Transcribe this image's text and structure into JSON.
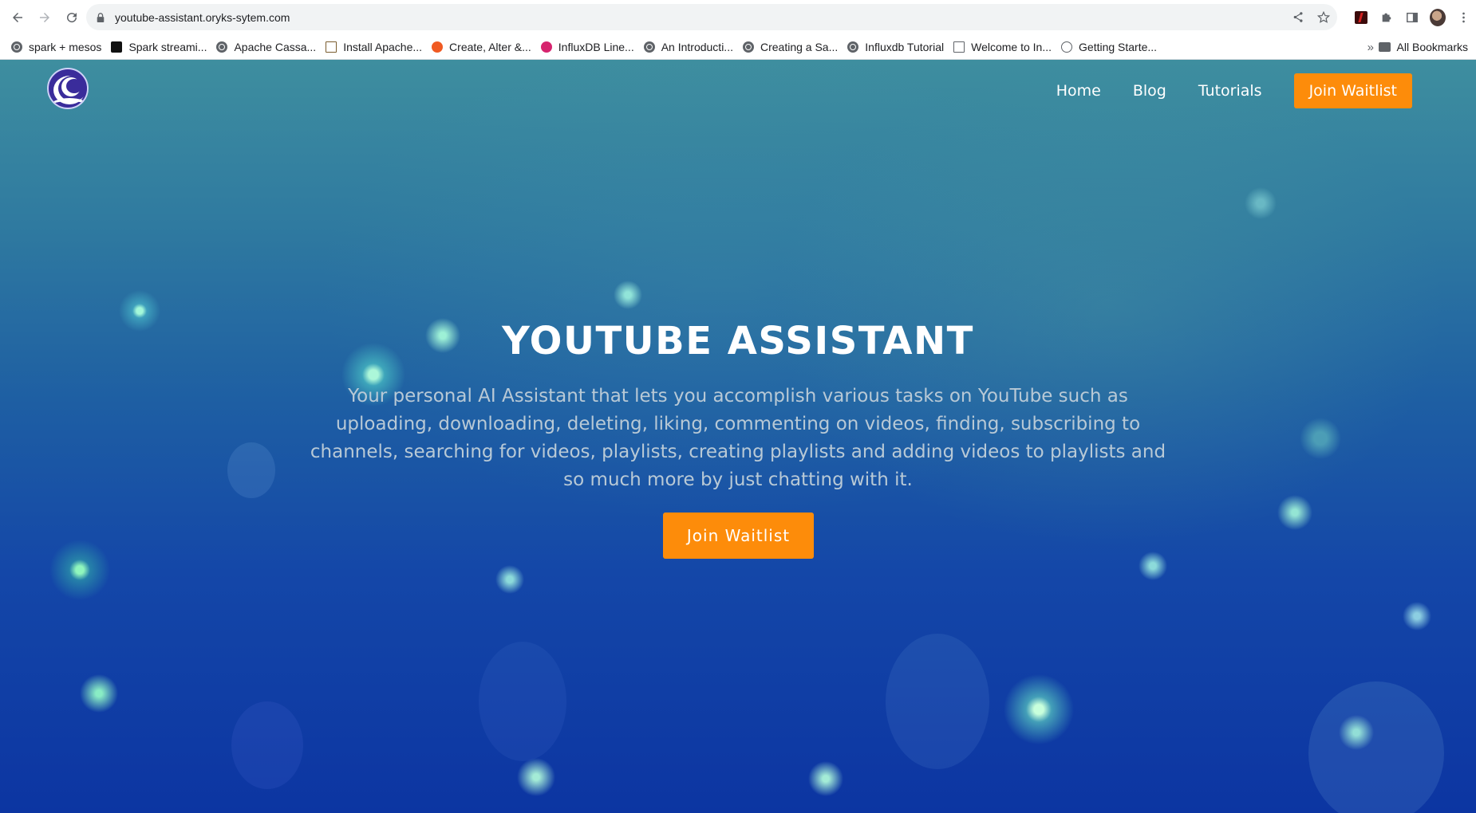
{
  "browser": {
    "url": "youtube-assistant.oryks-sytem.com",
    "bookmarks": [
      {
        "label": "spark + mesos",
        "icon": "globe-icon"
      },
      {
        "label": "Spark streami...",
        "icon": "site-icon"
      },
      {
        "label": "Apache Cassa...",
        "icon": "globe-icon"
      },
      {
        "label": "Install Apache...",
        "icon": "chart-icon"
      },
      {
        "label": "Create, Alter &...",
        "icon": "site-icon"
      },
      {
        "label": "InfluxDB Line...",
        "icon": "influx-icon"
      },
      {
        "label": "An Introducti...",
        "icon": "globe-icon"
      },
      {
        "label": "Creating a Sa...",
        "icon": "globe-icon"
      },
      {
        "label": "Influxdb Tutorial",
        "icon": "globe-icon"
      },
      {
        "label": "Welcome to In...",
        "icon": "grid-icon"
      },
      {
        "label": "Getting Starte...",
        "icon": "gear-icon"
      }
    ],
    "more_label": "»",
    "all_bookmarks_label": "All Bookmarks"
  },
  "header": {
    "nav": {
      "home": "Home",
      "blog": "Blog",
      "tutorials": "Tutorials",
      "cta": "Join Waitlist"
    }
  },
  "hero": {
    "title": "YOUTUBE ASSISTANT",
    "description": "Your personal AI Assistant that lets you accomplish various tasks on YouTube such as uploading, downloading, deleting, liking, commenting on videos, finding, subscribing to channels, searching for videos, playlists, creating playlists and adding videos to playlists and so much more by just chatting with it.",
    "cta": "Join Waitlist"
  },
  "colors": {
    "accent": "#fd8c0a",
    "hero_text": "#b8c9d6",
    "logo_bg": "#3a2c9b"
  }
}
